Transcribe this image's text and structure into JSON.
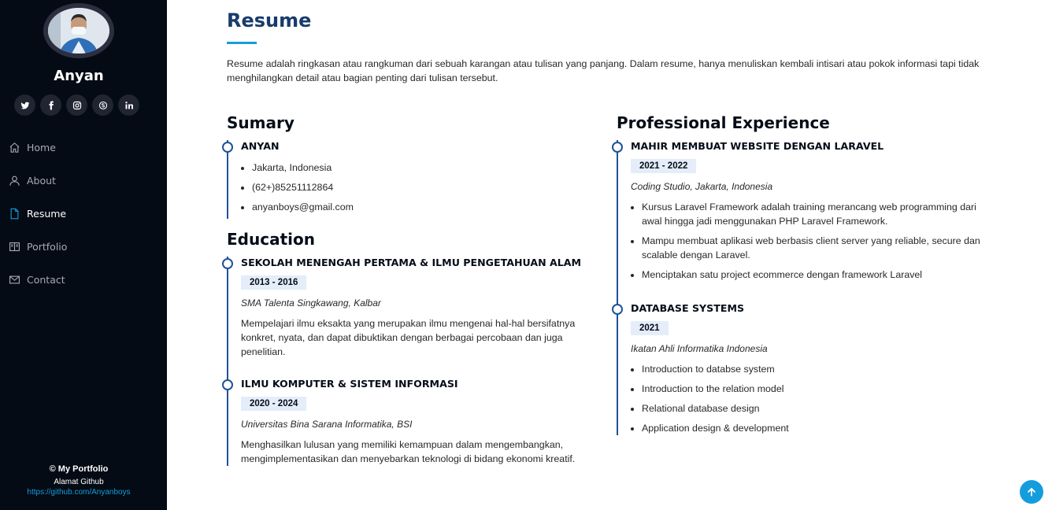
{
  "sidebar": {
    "name": "Anyan",
    "socials": [
      {
        "icon": "twitter-icon"
      },
      {
        "icon": "facebook-icon"
      },
      {
        "icon": "instagram-icon"
      },
      {
        "icon": "skype-icon"
      },
      {
        "icon": "linkedin-icon"
      }
    ],
    "nav": [
      {
        "label": "Home",
        "icon": "home-icon"
      },
      {
        "label": "About",
        "icon": "person-icon"
      },
      {
        "label": "Resume",
        "icon": "file-icon",
        "active": true
      },
      {
        "label": "Portfolio",
        "icon": "book-icon"
      },
      {
        "label": "Contact",
        "icon": "envelope-icon"
      }
    ],
    "footer": {
      "copyright_symbol": "©",
      "copyright_text": "My Portfolio",
      "github_label": "Alamat Github",
      "github_link": "https://github.com/Anyanboys"
    }
  },
  "main": {
    "title": "Resume",
    "intro": "Resume adalah ringkasan atau rangkuman dari sebuah karangan atau tulisan yang panjang. Dalam resume, hanya menuliskan kembali intisari atau pokok informasi tapi tidak menghilangkan detail atau bagian penting dari tulisan tersebut.",
    "summary": {
      "heading": "Sumary",
      "name": "ANYAN",
      "items": [
        "Jakarta, Indonesia",
        "(62+)85251112864",
        "anyanboys@gmail.com"
      ]
    },
    "education": {
      "heading": "Education",
      "entries": [
        {
          "title": "SEKOLAH MENENGAH PERTAMA & ILMU PENGETAHUAN ALAM",
          "date": "2013 - 2016",
          "org": "SMA Talenta Singkawang, Kalbar",
          "desc": "Mempelajari ilmu eksakta yang merupakan ilmu mengenai hal-hal bersifatnya konkret, nyata, dan dapat dibuktikan dengan berbagai percobaan dan juga penelitian."
        },
        {
          "title": "ILMU KOMPUTER & SISTEM INFORMASI",
          "date": "2020 - 2024",
          "org": "Universitas Bina Sarana Informatika, BSI",
          "desc": "Menghasilkan lulusan yang memiliki kemampuan dalam mengembangkan, mengimplementasikan dan menyebarkan teknologi di bidang ekonomi kreatif."
        }
      ]
    },
    "experience": {
      "heading": "Professional Experience",
      "entries": [
        {
          "title": "MAHIR MEMBUAT WEBSITE DENGAN LARAVEL",
          "date": "2021 - 2022",
          "org": "Coding Studio, Jakarta, Indonesia",
          "items": [
            "Kursus Laravel Framework adalah training merancang web programming dari awal hingga jadi menggunakan PHP Laravel Framework.",
            "Mampu membuat aplikasi web berbasis client server yang reliable, secure dan scalable dengan Laravel.",
            "Menciptakan satu project ecommerce dengan framework Laravel"
          ]
        },
        {
          "title": "DATABASE SYSTEMS",
          "date": "2021",
          "org": "Ikatan Ahli Informatika Indonesia",
          "items": [
            "Introduction to databse system",
            "Introduction to the relation model",
            "Relational database design",
            "Application design & development"
          ]
        }
      ]
    }
  },
  "colors": {
    "accent": "#149ddd",
    "sidebar_bg": "#040b14",
    "title": "#173b6c",
    "date_bg": "#e4edf9",
    "timeline": "#1f5297"
  }
}
